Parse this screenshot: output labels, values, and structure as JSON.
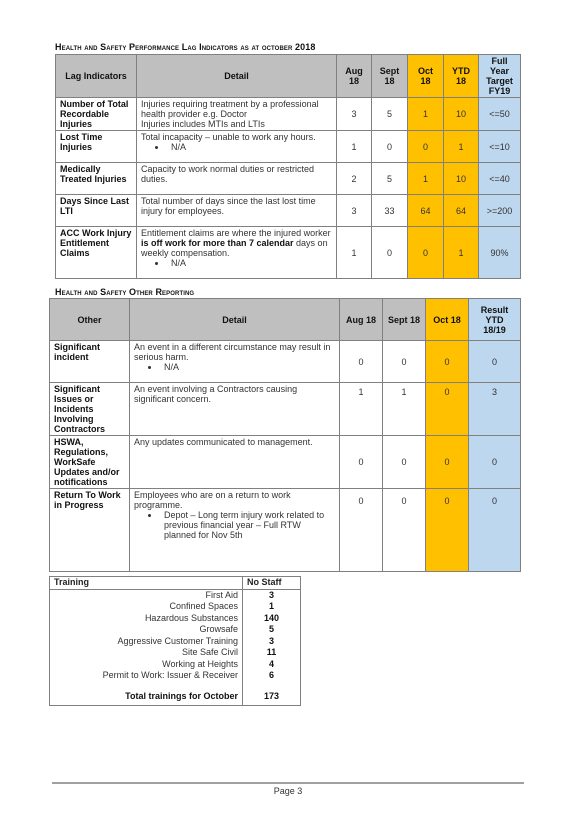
{
  "lag_section": {
    "heading": "Health and Safety Performance Lag Indicators as at october 2018",
    "headers": {
      "indicator": "Lag Indicators",
      "detail": "Detail",
      "aug": "Aug 18",
      "sept": "Sept 18",
      "oct": "Oct 18",
      "ytd": "YTD 18",
      "target": "Full Year Target FY19"
    },
    "rows": [
      {
        "label": "Number of Total Recordable Injuries",
        "detail_lines": [
          "Injuries requiring treatment by a professional health provider e.g. Doctor",
          "Injuries includes MTIs and LTIs"
        ],
        "bullet": "",
        "aug": "3",
        "sept": "5",
        "oct": "1",
        "ytd": "10",
        "target": "<=50"
      },
      {
        "label": "Lost Time Injuries",
        "detail_lines": [
          "Total incapacity – unable to work any hours."
        ],
        "bullet": "N/A",
        "aug": "1",
        "sept": "0",
        "oct": "0",
        "ytd": "1",
        "target": "<=10"
      },
      {
        "label": "Medically Treated Injuries",
        "detail_lines": [
          "Capacity to work normal duties or restricted duties."
        ],
        "bullet": "",
        "aug": "2",
        "sept": "5",
        "oct": "1",
        "ytd": "10",
        "target": "<=40"
      },
      {
        "label": "Days Since Last LTI",
        "detail_lines": [
          "Total number of days since the last lost time injury for employees."
        ],
        "bullet": "",
        "aug": "3",
        "sept": "33",
        "oct": "64",
        "ytd": "64",
        "target": ">=200"
      },
      {
        "label": "ACC Work Injury Entitlement Claims",
        "detail_pre": "Entitlement claims are where the injured worker ",
        "detail_bold": "is off work for more than 7 calendar",
        "detail_post": " days on weekly compensation.",
        "bullet": "N/A",
        "aug": "1",
        "sept": "0",
        "oct": "0",
        "ytd": "1",
        "target": "90%"
      }
    ]
  },
  "other_section": {
    "heading": "Health and Safety Other Reporting",
    "headers": {
      "other": "Other",
      "detail": "Detail",
      "aug": "Aug 18",
      "sept": "Sept 18",
      "oct": "Oct 18",
      "result": "Result YTD 18/19"
    },
    "rows": [
      {
        "label": "Significant incident",
        "detail": "An event in a different circumstance may result in serious harm.",
        "bullet": "N/A",
        "aug": "0",
        "sept": "0",
        "oct": "0",
        "result": "0"
      },
      {
        "label": "Significant Issues or Incidents Involving Contractors",
        "detail": "An event involving a Contractors causing significant concern.",
        "bullet": "",
        "aug": "1",
        "sept": "1",
        "oct": "0",
        "result": "3"
      },
      {
        "label": "HSWA, Regulations, WorkSafe Updates and/or notifications",
        "detail": "Any updates communicated to management.",
        "bullet": "",
        "aug": "0",
        "sept": "0",
        "oct": "0",
        "result": "0"
      },
      {
        "label": "Return To Work in Progress",
        "detail": "Employees who are on a return to work programme.",
        "bullet": "Depot – Long term injury work related to previous financial year – Full RTW planned for Nov 5th",
        "aug": "0",
        "sept": "0",
        "oct": "0",
        "result": "0"
      }
    ]
  },
  "training": {
    "header_name": "Training",
    "header_count": "No Staff",
    "items": [
      {
        "name": "First Aid",
        "count": "3"
      },
      {
        "name": "Confined Spaces",
        "count": "1"
      },
      {
        "name": "Hazardous Substances",
        "count": "140"
      },
      {
        "name": "Growsafe",
        "count": "5"
      },
      {
        "name": "Aggressive Customer Training",
        "count": "3"
      },
      {
        "name": "Site Safe Civil",
        "count": "11"
      },
      {
        "name": "Working at Heights",
        "count": "4"
      },
      {
        "name": "Permit to Work: Issuer & Receiver",
        "count": "6"
      }
    ],
    "total_label": "Total trainings for October",
    "total_count": "173"
  },
  "footer": {
    "page": "Page 3"
  },
  "colors": {
    "header_grey": "#bfbfbf",
    "current_month": "#ffc000",
    "target_blue": "#bdd7ee"
  }
}
